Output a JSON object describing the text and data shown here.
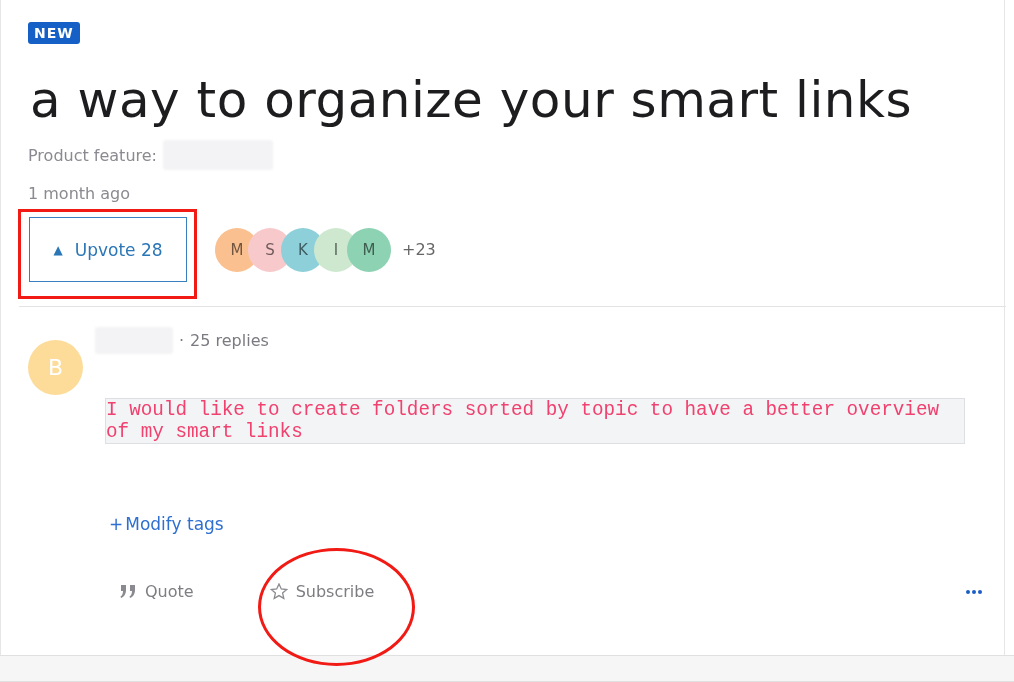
{
  "badge": "NEW",
  "title": "a way to organize your smart links",
  "product_feature": {
    "label": "Product feature:"
  },
  "time": "1 month ago",
  "upvote": {
    "icon": "▲",
    "label": "Upvote 28"
  },
  "voters": [
    {
      "initial": "M",
      "color": "#fbc08f"
    },
    {
      "initial": "S",
      "color": "#f8c9cb"
    },
    {
      "initial": "K",
      "color": "#8ed0da"
    },
    {
      "initial": "I",
      "color": "#cde8cf"
    },
    {
      "initial": "M",
      "color": "#8dd2b3"
    }
  ],
  "more_voters": "+23",
  "post": {
    "avatar": {
      "initial": "B",
      "color": "#fddc9a"
    },
    "separator": "·",
    "replies": "25 replies",
    "body": "I would like to create folders sorted by topic to have a better overview of my smart links"
  },
  "modify_tags": {
    "icon": "+",
    "label": "Modify tags"
  },
  "actions": [
    {
      "kind": "quote",
      "label": "Quote"
    },
    {
      "kind": "subscribe",
      "label": "Subscribe"
    },
    {
      "kind": "more"
    }
  ],
  "annotations": [
    {
      "kind": "rectangle"
    },
    {
      "kind": "ellipse"
    }
  ]
}
